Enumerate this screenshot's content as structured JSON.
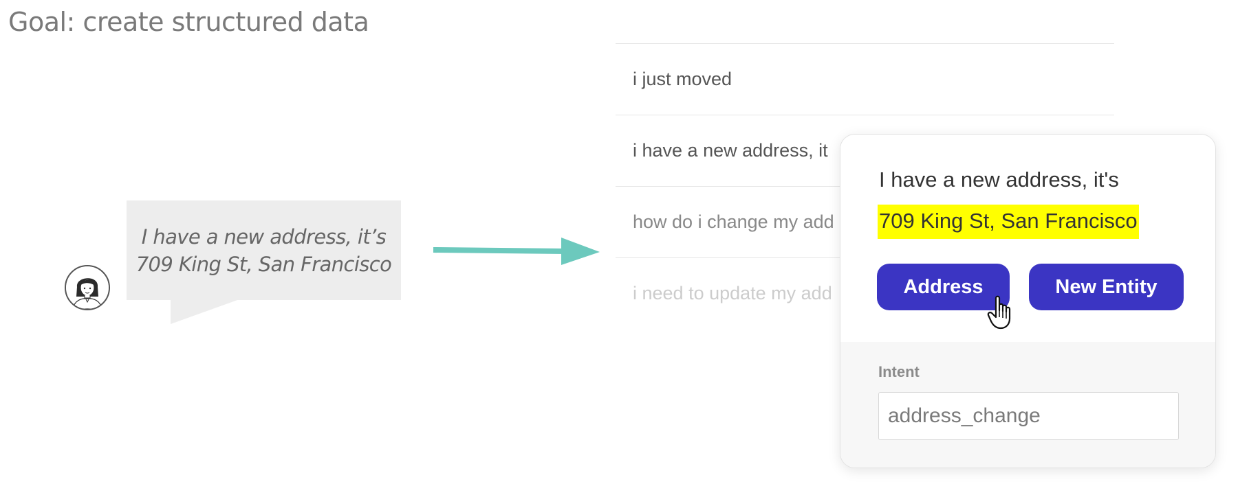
{
  "header": {
    "goal_title": "Goal: create structured data"
  },
  "chat": {
    "bubble_line_1": "I have a new address, it’s",
    "bubble_line_2": "709 King St, San Francisco"
  },
  "colors": {
    "arrow": "#6cc9bd",
    "button": "#3b35c3",
    "highlight": "#ffff00"
  },
  "utterances": [
    {
      "text": "i just moved",
      "color": "#555555"
    },
    {
      "text": "i have a new address, it",
      "color": "#555555"
    },
    {
      "text": "how do i change my add",
      "color": "#888888"
    },
    {
      "text": "i need to update my add",
      "color": "#cccccc"
    }
  ],
  "popup": {
    "text_line_1": "I have a new address, it's",
    "highlighted_entity": "709 King St, San Francisco",
    "address_button": "Address",
    "new_entity_button": "New Entity",
    "intent_label": "Intent",
    "intent_value": "address_change"
  }
}
